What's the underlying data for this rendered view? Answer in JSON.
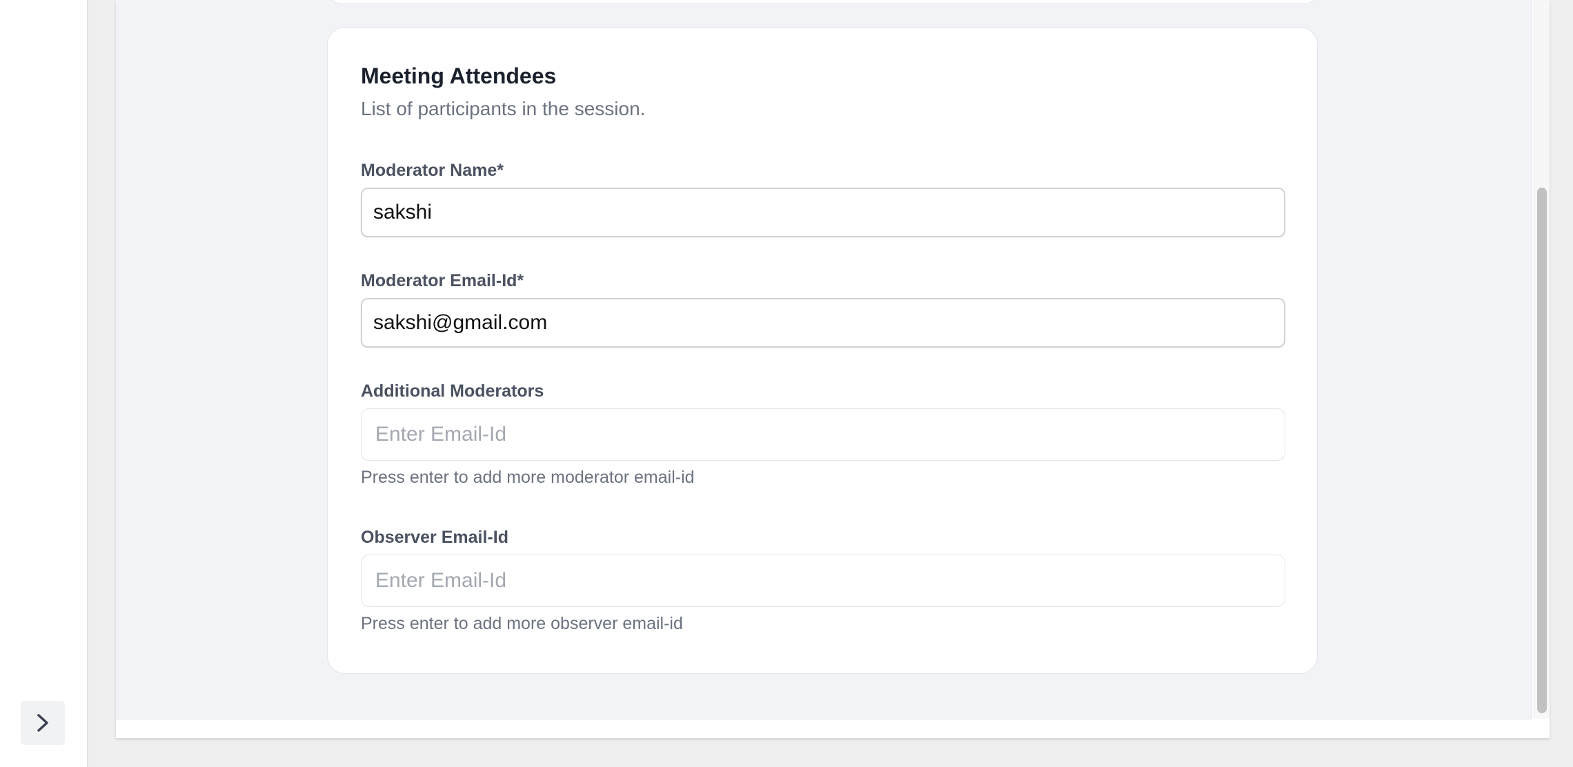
{
  "section": {
    "title": "Meeting Attendees",
    "subtitle": "List of participants in the session."
  },
  "fields": {
    "moderator_name": {
      "label": "Moderator Name*",
      "value": "sakshi"
    },
    "moderator_email": {
      "label": "Moderator Email-Id*",
      "value": "sakshi@gmail.com"
    },
    "additional_moderators": {
      "label": "Additional Moderators",
      "placeholder": "Enter Email-Id",
      "help": "Press enter to add more moderator email-id"
    },
    "observer_email": {
      "label": "Observer Email-Id",
      "placeholder": "Enter Email-Id",
      "help": "Press enter to add more observer email-id"
    }
  },
  "icons": {
    "expand": "chevron-right-icon"
  },
  "colors": {
    "page_bg": "#efefef",
    "content_bg": "#f2f3f6",
    "card_bg": "#ffffff",
    "title": "#1a202c",
    "muted": "#6b7280"
  }
}
